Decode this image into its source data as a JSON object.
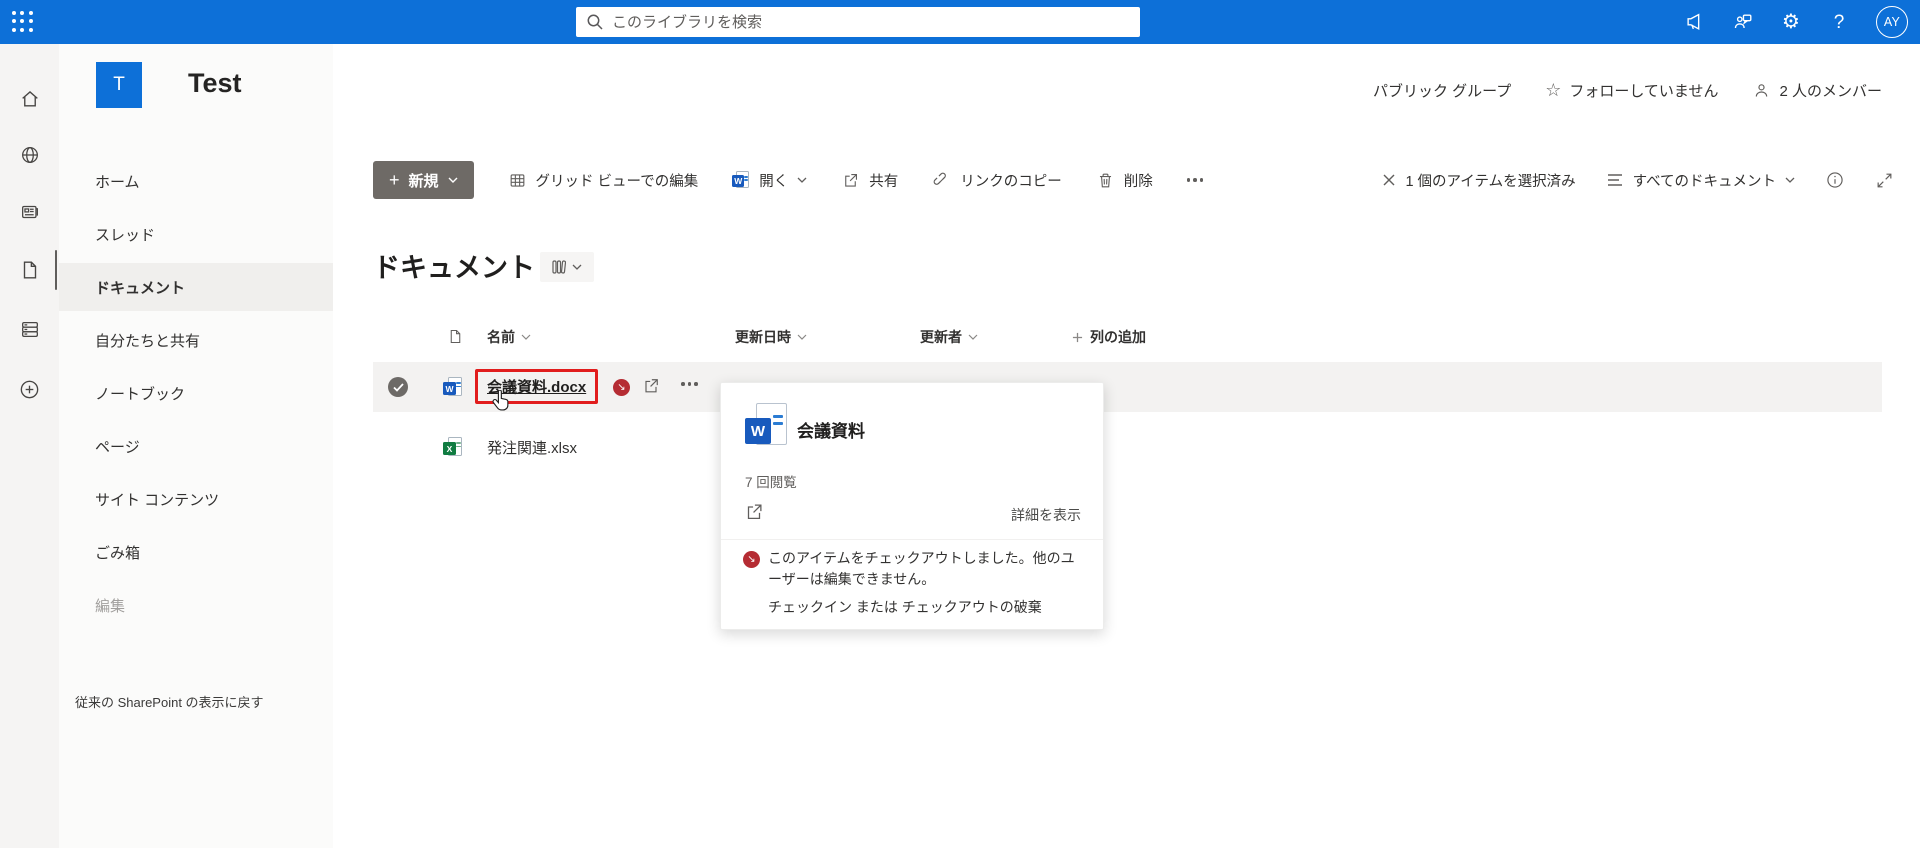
{
  "colors": {
    "brand_blue": "#0d70d8",
    "new_button_gray": "#6e6a66",
    "selected_row": "#f3f2f1",
    "annotation_red": "#e11d1d",
    "checked_out_red": "#b52c33",
    "word_blue": "#185abd",
    "excel_green": "#107c41"
  },
  "icons": {
    "plus": "+",
    "gear": "⚙",
    "help": "?",
    "star": "☆",
    "checked_out_arrow": "↘",
    "word_letter": "W",
    "excel_letter": "X"
  },
  "suite_bar": {
    "search_placeholder": "このライブラリを検索",
    "avatar_initials": "AY"
  },
  "site_header": {
    "logo_letter": "T",
    "title": "Test",
    "privacy_label": "パブリック グループ",
    "follow_label": "フォローしていません",
    "members_label": "2 人のメンバー"
  },
  "nav": {
    "items": [
      {
        "label": "ホーム"
      },
      {
        "label": "スレッド"
      },
      {
        "label": "ドキュメント",
        "selected": true
      },
      {
        "label": "自分たちと共有"
      },
      {
        "label": "ノートブック"
      },
      {
        "label": "ページ"
      },
      {
        "label": "サイト コンテンツ"
      },
      {
        "label": "ごみ箱"
      },
      {
        "label": "編集",
        "disabled": true
      }
    ],
    "footer_link": "従来の SharePoint の表示に戻す"
  },
  "toolbar": {
    "new_label": "新規",
    "edit_grid_label": "グリッド ビューでの編集",
    "open_label": "開く",
    "share_label": "共有",
    "copy_link_label": "リンクのコピー",
    "delete_label": "削除",
    "selection_status": "1 個のアイテムを選択済み",
    "view_selector_label": "すべてのドキュメント"
  },
  "main": {
    "title": "ドキュメント",
    "table": {
      "columns": [
        "名前",
        "更新日時",
        "更新者"
      ],
      "add_column_label": "列の追加",
      "rows": [
        {
          "name": "会議資料.docx",
          "type": "word",
          "selected": true,
          "checked_out": true
        },
        {
          "name": "発注関連.xlsx",
          "type": "excel"
        }
      ]
    }
  },
  "hover_card": {
    "title": "会議資料",
    "views": "7 回閲覧",
    "details_label": "詳細を表示",
    "checkout_message": "このアイテムをチェックアウトしました。他のユーザーは編集できません。",
    "checkin_link": "チェックイン または チェックアウトの破棄"
  }
}
